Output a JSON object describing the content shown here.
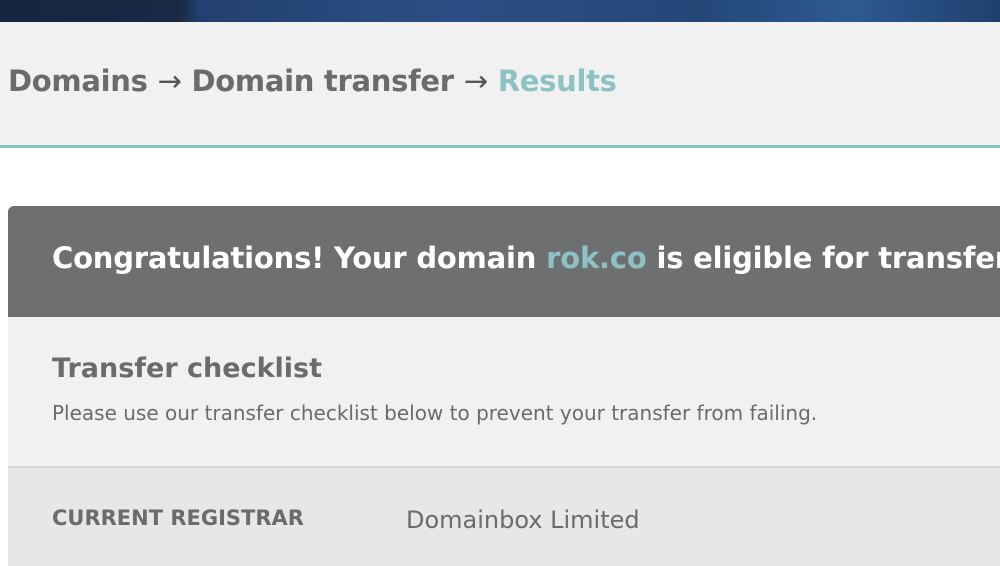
{
  "breadcrumb": {
    "items": [
      "Domains",
      "Domain transfer"
    ],
    "separator": "→",
    "current": "Results"
  },
  "result": {
    "prefix": "Congratulations! Your domain ",
    "domain": "rok.co",
    "suffix": " is eligible for transfer"
  },
  "checklist": {
    "title": "Transfer checklist",
    "description": "Please use our transfer checklist below to prevent your transfer from failing."
  },
  "registrar": {
    "label": "CURRENT REGISTRAR",
    "value": "Domainbox Limited"
  },
  "colors": {
    "accent": "#8cc2c3",
    "header_bg": "#6e6f71",
    "text": "#6a6b6d"
  }
}
